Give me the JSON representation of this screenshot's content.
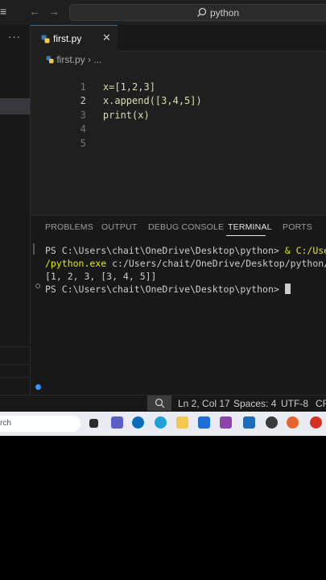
{
  "search": {
    "text": "python"
  },
  "tab": {
    "label": "first.py"
  },
  "breadcrumb": {
    "file": "first.py",
    "sep": "›",
    "more": "..."
  },
  "editor": {
    "lines": [
      {
        "no": "1",
        "code": "x=[1,2,3]"
      },
      {
        "no": "2",
        "code": "x.append([3,4,5])"
      },
      {
        "no": "3",
        "code": "print(x)"
      },
      {
        "no": "4",
        "code": ""
      },
      {
        "no": "5",
        "code": ""
      }
    ]
  },
  "panel": {
    "tabs": [
      "PROBLEMS",
      "OUTPUT",
      "DEBUG CONSOLE",
      "TERMINAL",
      "PORTS"
    ],
    "terminal": {
      "line1_prompt": "PS C:\\Users\\chait\\OneDrive\\Desktop\\python> ",
      "line1_cmd": "& C:/Users/",
      "line2_exe": "/python.exe",
      "line2_path": " c:/Users/chait/OneDrive/Desktop/python/fir",
      "line3": "[1, 2, 3, [3, 4, 5]]",
      "line4": "PS C:\\Users\\chait\\OneDrive\\Desktop\\python> "
    }
  },
  "status": {
    "position": "Ln 2, Col 17",
    "spaces": "Spaces: 4",
    "encoding": "UTF-8",
    "eol": "CR"
  },
  "taskbar": {
    "search": "rch"
  },
  "colors": {
    "accent": "#0078d4",
    "keyword": "#dcdcaa",
    "bracket": "#da70d6"
  }
}
